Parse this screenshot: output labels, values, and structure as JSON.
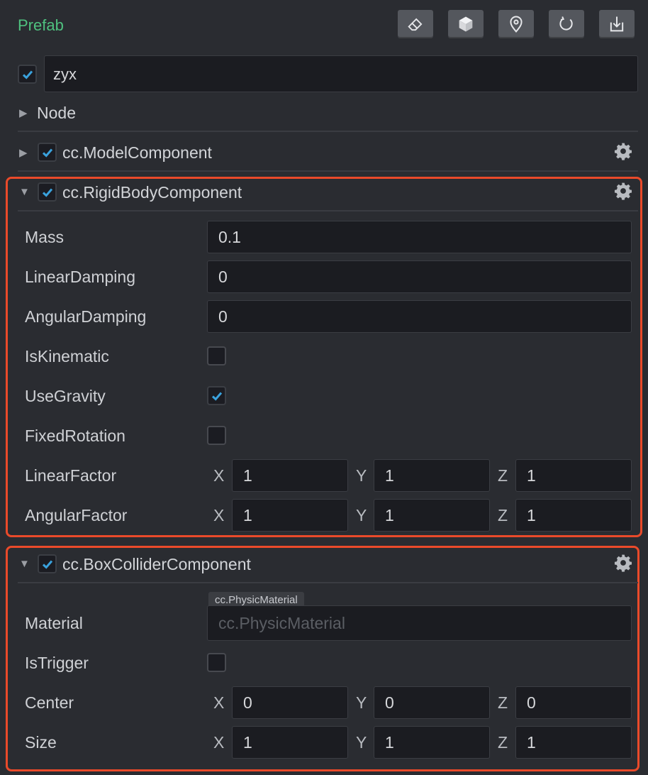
{
  "header": {
    "title": "Prefab",
    "tools": [
      {
        "name": "eraser-icon"
      },
      {
        "name": "cube-icon"
      },
      {
        "name": "location-pin-icon"
      },
      {
        "name": "refresh-icon"
      },
      {
        "name": "save-download-icon"
      }
    ]
  },
  "node": {
    "enabled": true,
    "name": "zyx"
  },
  "sections": {
    "node": {
      "label": "Node",
      "expanded": false
    },
    "model": {
      "label": "cc.ModelComponent",
      "enabled": true,
      "expanded": false
    },
    "rigid": {
      "label": "cc.RigidBodyComponent",
      "enabled": true,
      "expanded": true,
      "props": {
        "mass": {
          "label": "Mass",
          "value": "0.1"
        },
        "linear_damping": {
          "label": "LinearDamping",
          "value": "0"
        },
        "angular_damping": {
          "label": "AngularDamping",
          "value": "0"
        },
        "is_kinematic": {
          "label": "IsKinematic",
          "checked": false
        },
        "use_gravity": {
          "label": "UseGravity",
          "checked": true
        },
        "fixed_rotation": {
          "label": "FixedRotation",
          "checked": false
        },
        "linear_factor": {
          "label": "LinearFactor",
          "x": "1",
          "y": "1",
          "z": "1"
        },
        "angular_factor": {
          "label": "AngularFactor",
          "x": "1",
          "y": "1",
          "z": "1"
        }
      }
    },
    "box": {
      "label": "cc.BoxColliderComponent",
      "enabled": true,
      "expanded": true,
      "props": {
        "material": {
          "label": "Material",
          "tag": "cc.PhysicMaterial",
          "placeholder": "cc.PhysicMaterial"
        },
        "is_trigger": {
          "label": "IsTrigger",
          "checked": false
        },
        "center": {
          "label": "Center",
          "x": "0",
          "y": "0",
          "z": "0"
        },
        "size": {
          "label": "Size",
          "x": "1",
          "y": "1",
          "z": "1"
        }
      }
    }
  },
  "axes": {
    "x": "X",
    "y": "Y",
    "z": "Z"
  },
  "colors": {
    "accent_green": "#4fc17f",
    "check_blue": "#3aa2dd",
    "highlight_red": "#ea4a2a",
    "background": "#2a2c31"
  }
}
